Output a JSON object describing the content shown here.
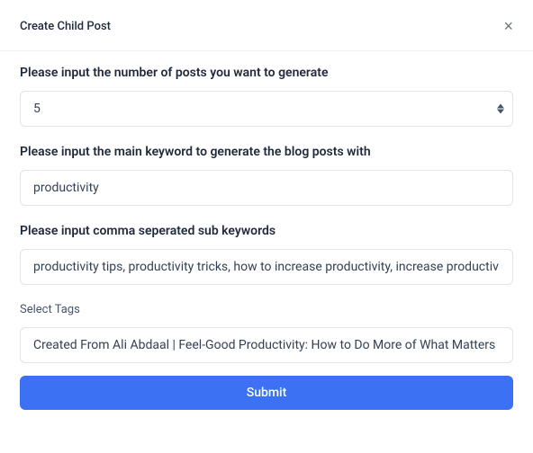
{
  "header": {
    "title": "Create Child Post",
    "close_glyph": "×"
  },
  "form": {
    "posts_count": {
      "label": "Please input the number of posts you want to generate",
      "value": "5"
    },
    "main_keyword": {
      "label": "Please input the main keyword to generate the blog posts with",
      "value": "productivity"
    },
    "sub_keywords": {
      "label": "Please input comma seperated sub keywords",
      "value": "productivity tips, productivity tricks, how to increase productivity, increase productivity"
    },
    "tags": {
      "label": "Select Tags",
      "value": "Created From Ali Abdaal | Feel-Good Productivity: How to Do More of What Matters"
    },
    "submit_label": "Submit"
  }
}
